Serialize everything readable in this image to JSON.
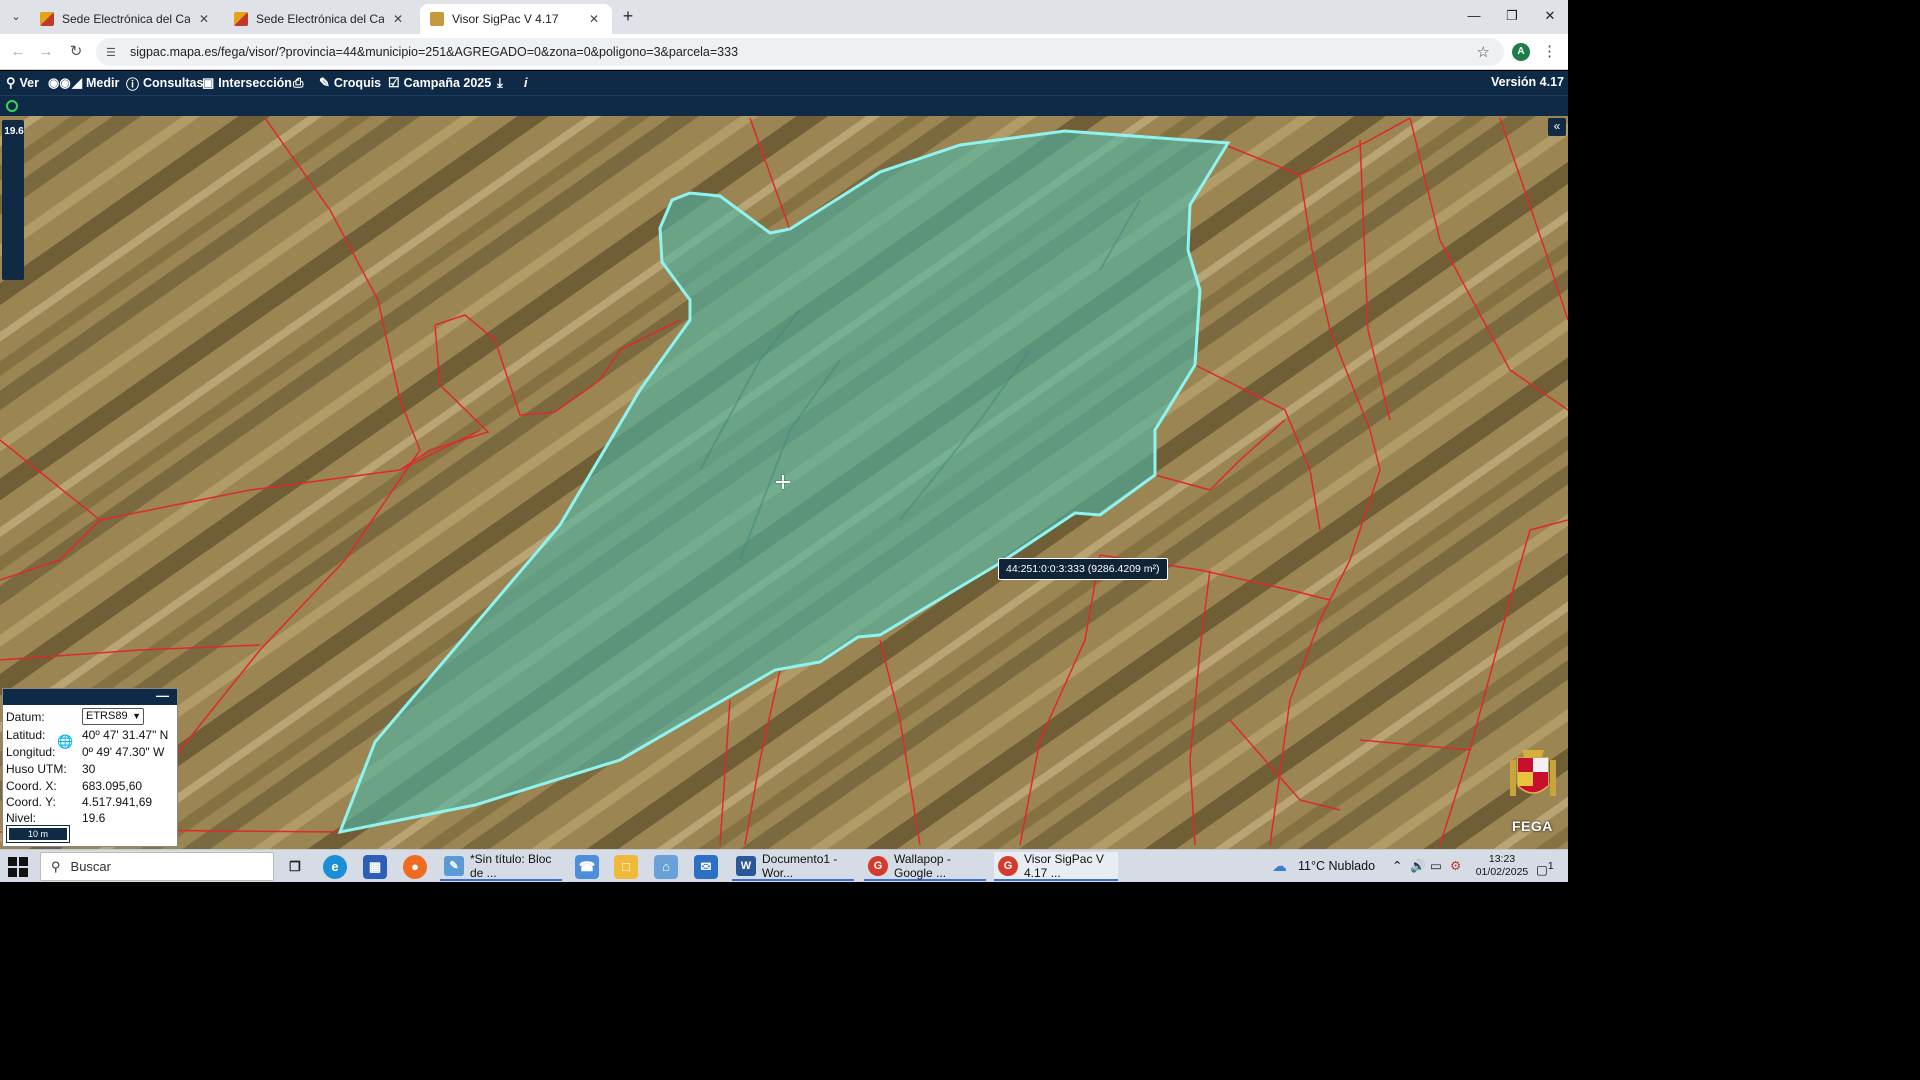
{
  "browser": {
    "tabs": [
      {
        "title": "Sede Electrónica del Catastro -"
      },
      {
        "title": "Sede Electrónica del Catastro"
      },
      {
        "title": "Visor SigPac V 4.17"
      }
    ],
    "url": "sigpac.mapa.es/fega/visor/?provincia=44&municipio=251&AGREGADO=0&zona=0&poligono=3&parcela=333",
    "profile_initial": "A"
  },
  "toolbar": {
    "ver": "Ver",
    "medir": "Medir",
    "consultas": "Consultas",
    "interseccion": "Intersección",
    "croquis": "Croquis",
    "campana": "Campaña 2025",
    "info": "i",
    "version": "Versión 4.17"
  },
  "map": {
    "zoom_level": "19.6",
    "parcel_tooltip": "44:251:0:0:3:333 (9286.4209 m²)",
    "parcel_fill": "#4fb7a6",
    "parcel_stroke": "#8ff4f0",
    "boundary_color": "#e0282a"
  },
  "coords": {
    "datum_label": "Datum:",
    "datum_value": "ETRS89",
    "lat_label": "Latitud:",
    "lat_value": "40º 47' 31.47\" N",
    "lon_label": "Longitud:",
    "lon_value": "0º 49' 47.30\" W",
    "huso_label": "Huso UTM:",
    "huso_value": "30",
    "x_label": "Coord. X:",
    "x_value": "683.095,60",
    "y_label": "Coord. Y:",
    "y_value": "4.517.941,69",
    "nivel_label": "Nivel:",
    "nivel_value": "19.6",
    "scale": "10 m"
  },
  "logo": {
    "text": "FEGA"
  },
  "taskbar": {
    "search_placeholder": "Buscar",
    "apps": [
      {
        "label": "*Sin título: Bloc de ..."
      },
      {
        "label": "Documento1 - Wor..."
      },
      {
        "label": "Wallapop - Google ..."
      },
      {
        "label": "Visor SigPac V 4.17 ..."
      }
    ],
    "weather": "11°C  Nublado",
    "time": "13:23",
    "date": "01/02/2025",
    "notifications": "1"
  }
}
